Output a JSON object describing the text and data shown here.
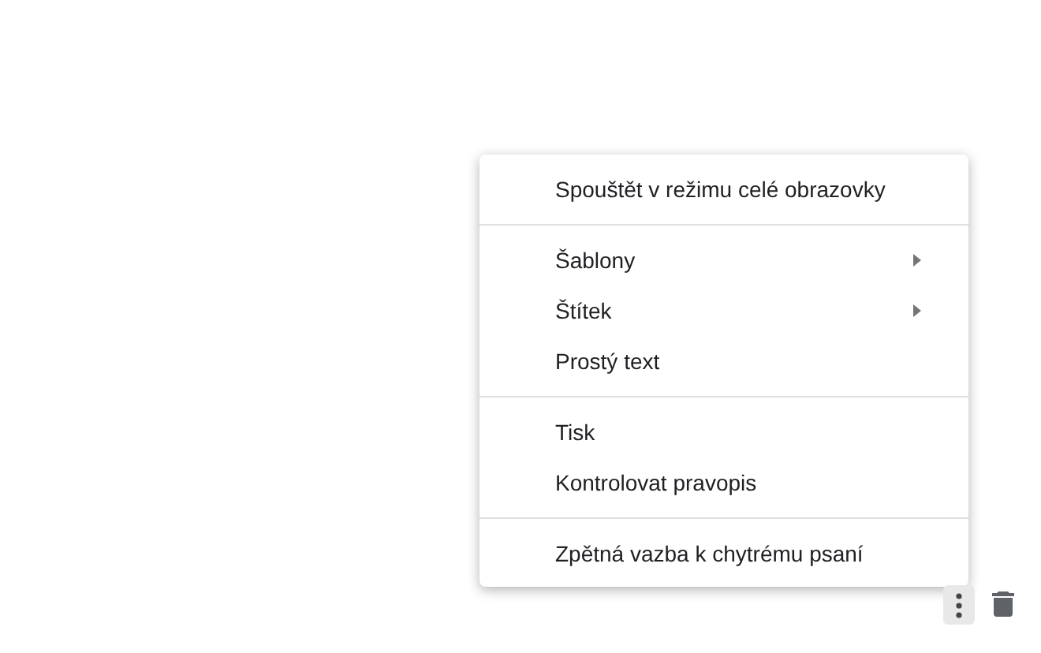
{
  "menu": {
    "groups": [
      {
        "items": [
          {
            "label": "Spouštět v režimu celé obrazovky",
            "has_submenu": false
          }
        ]
      },
      {
        "items": [
          {
            "label": "Šablony",
            "has_submenu": true
          },
          {
            "label": "Štítek",
            "has_submenu": true
          },
          {
            "label": "Prostý text",
            "has_submenu": false
          }
        ]
      },
      {
        "items": [
          {
            "label": "Tisk",
            "has_submenu": false
          },
          {
            "label": "Kontrolovat pravopis",
            "has_submenu": false
          }
        ]
      },
      {
        "items": [
          {
            "label": "Zpětná vazba k chytrému psaní",
            "has_submenu": false
          }
        ]
      }
    ]
  },
  "toolbar": {
    "more_button": {
      "selected": true
    }
  }
}
